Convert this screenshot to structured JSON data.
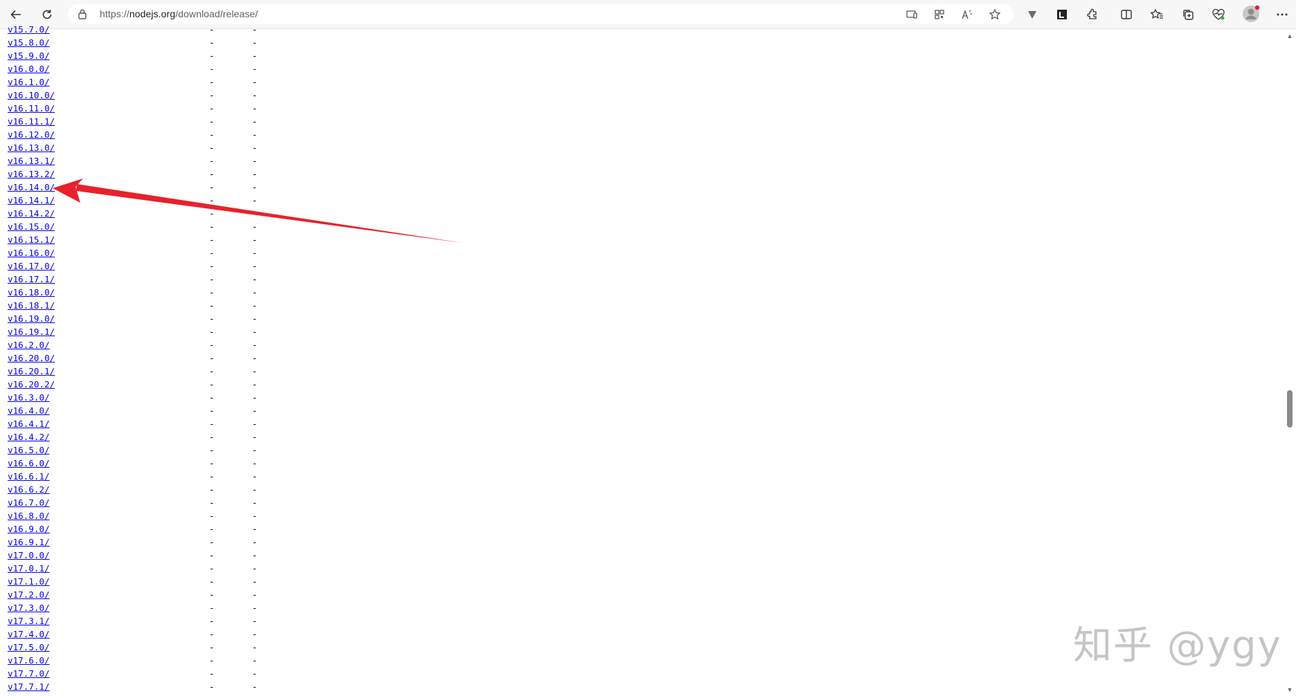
{
  "browser": {
    "url_prefix": "https://",
    "url_domain": "nodejs.org",
    "url_path": "/download/release/",
    "icons": {
      "back": "back-arrow-icon",
      "reload": "reload-icon",
      "lock": "lock-icon",
      "app_available": "app-available-icon",
      "qr": "qr-code-icon",
      "read_aloud": "read-aloud-icon",
      "favorite": "star-icon",
      "extension_v": "extension-v-icon",
      "extension_l": "extension-l-icon",
      "extensions": "puzzle-icon",
      "split_screen": "split-screen-icon",
      "favorites": "favorites-icon",
      "collections": "collections-icon",
      "performance": "heart-pulse-icon",
      "profile": "profile-avatar-icon",
      "menu": "more-menu-icon"
    }
  },
  "listing": {
    "dash": "-",
    "rows": [
      "v15.7.0/",
      "v15.8.0/",
      "v15.9.0/",
      "v16.0.0/",
      "v16.1.0/",
      "v16.10.0/",
      "v16.11.0/",
      "v16.11.1/",
      "v16.12.0/",
      "v16.13.0/",
      "v16.13.1/",
      "v16.13.2/",
      "v16.14.0/",
      "v16.14.1/",
      "v16.14.2/",
      "v16.15.0/",
      "v16.15.1/",
      "v16.16.0/",
      "v16.17.0/",
      "v16.17.1/",
      "v16.18.0/",
      "v16.18.1/",
      "v16.19.0/",
      "v16.19.1/",
      "v16.2.0/",
      "v16.20.0/",
      "v16.20.1/",
      "v16.20.2/",
      "v16.3.0/",
      "v16.4.0/",
      "v16.4.1/",
      "v16.4.2/",
      "v16.5.0/",
      "v16.6.0/",
      "v16.6.1/",
      "v16.6.2/",
      "v16.7.0/",
      "v16.8.0/",
      "v16.9.0/",
      "v16.9.1/",
      "v17.0.0/",
      "v17.0.1/",
      "v17.1.0/",
      "v17.2.0/",
      "v17.3.0/",
      "v17.3.1/",
      "v17.4.0/",
      "v17.5.0/",
      "v17.6.0/",
      "v17.7.0/",
      "v17.7.1/"
    ]
  },
  "annotation": {
    "color": "#e8212b",
    "points_to": "v16.14.0/"
  },
  "watermark": {
    "text": "知乎 @ygy"
  }
}
